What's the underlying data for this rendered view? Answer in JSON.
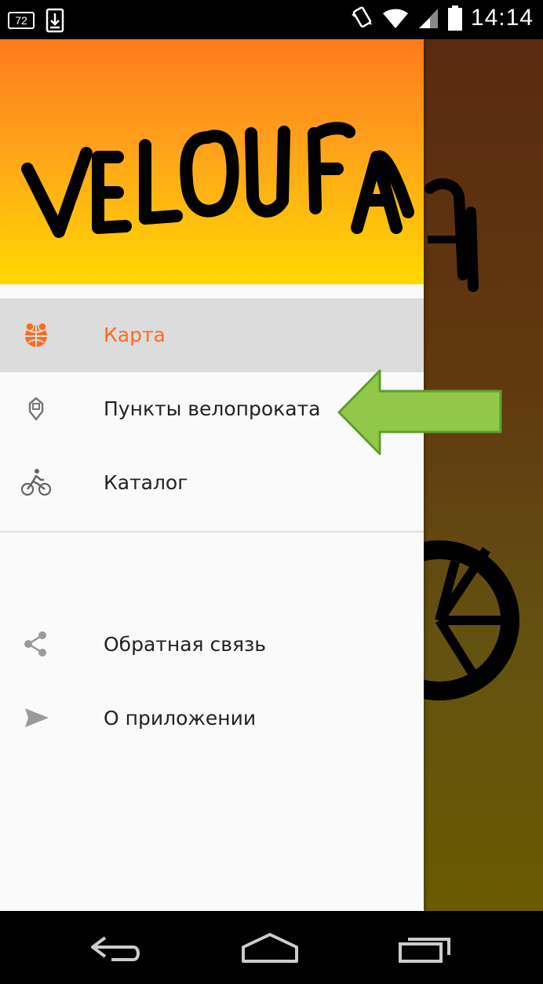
{
  "status_bar": {
    "notif_badge": "72",
    "time": "14:14"
  },
  "drawer": {
    "header_logo": "VELOUFA",
    "items": [
      {
        "label": "Карта",
        "icon": "globe-pin-icon",
        "selected": true
      },
      {
        "label": "Пункты велопроката",
        "icon": "rental-point-icon",
        "selected": false
      },
      {
        "label": "Каталог",
        "icon": "cyclist-icon",
        "selected": false
      }
    ],
    "secondary_items": [
      {
        "label": "Обратная связь",
        "icon": "share-icon"
      },
      {
        "label": "О приложении",
        "icon": "send-icon"
      }
    ]
  },
  "colors": {
    "accent": "#ff6a20",
    "header_top": "#ff7a1c",
    "header_bottom": "#ffd800",
    "pointer_arrow": "#92c84a"
  }
}
